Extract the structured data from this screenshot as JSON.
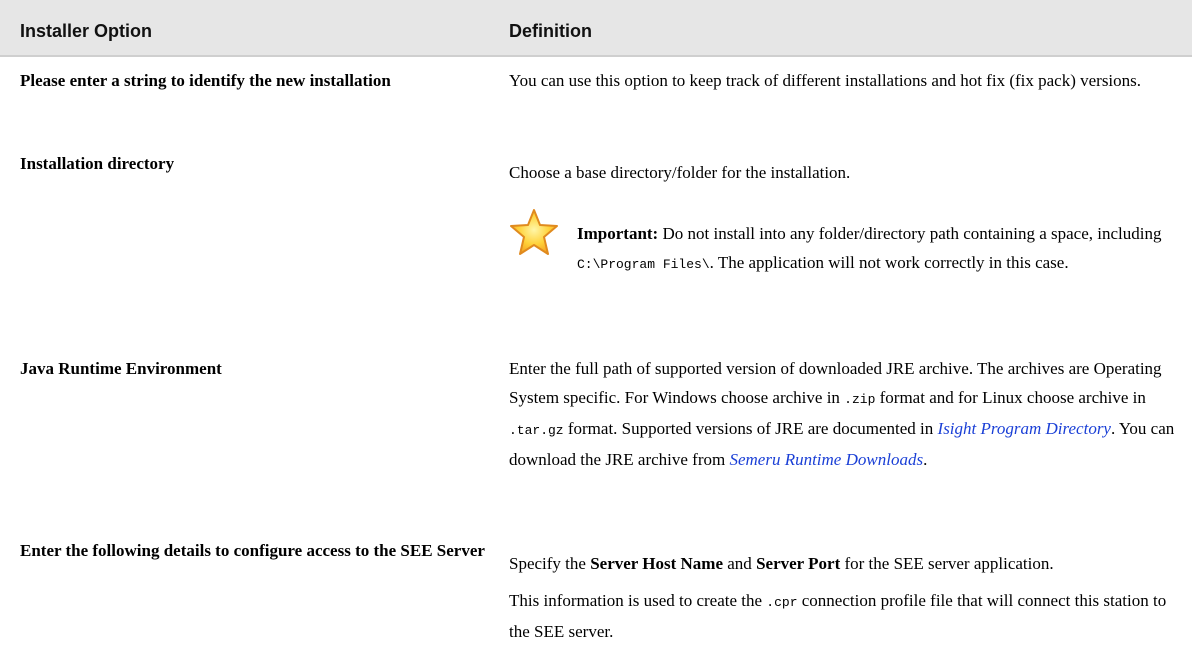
{
  "header": {
    "col1": "Installer Option",
    "col2": "Definition"
  },
  "rows": [
    {
      "option": "Please enter a string to identify the new installation",
      "def": "You can use this option to keep track of different installations and hot fix (fix pack) versions."
    },
    {
      "option": "Installation directory",
      "def": "Choose a base directory/folder for the installation.",
      "note": {
        "icon": "star-icon",
        "label": "Important:",
        "text1": "Do not install into any folder/directory path containing a space, including",
        "path": "C:\\Program Files\\",
        "text2": ". The application will not work correctly in this case."
      }
    },
    {
      "option": "Java Runtime Environment",
      "def1": "Enter the full path of supported version of downloaded JRE archive. The archives are Operating System specific. For Windows choose archive in",
      "zip": ".zip",
      "def2": "format and for Linux choose archive in",
      "targz": ".tar.gz",
      "def3": "format. Supported versions of JRE are documented in",
      "link1": "Isight Program Directory",
      "def4": ". You can download the JRE archive from",
      "link2": "Semeru Runtime Downloads",
      "def5": "."
    },
    {
      "option": "Enter the following details to configure access to the SEE Server",
      "def1_a": "Specify the",
      "host": "Server Host Name",
      "def1_b": "and",
      "port": "Server Port",
      "def1_c": "for the SEE server application.",
      "def2_a": "This information is used to create the",
      "cpr": ".cpr",
      "def2_b": "connection profile file that will connect this station to the SEE server."
    }
  ],
  "colors": {
    "header_bg": "#e6e6e6",
    "link": "#1a3fd6",
    "star_fill": "#ffd23a",
    "star_stroke": "#e08a1e"
  }
}
